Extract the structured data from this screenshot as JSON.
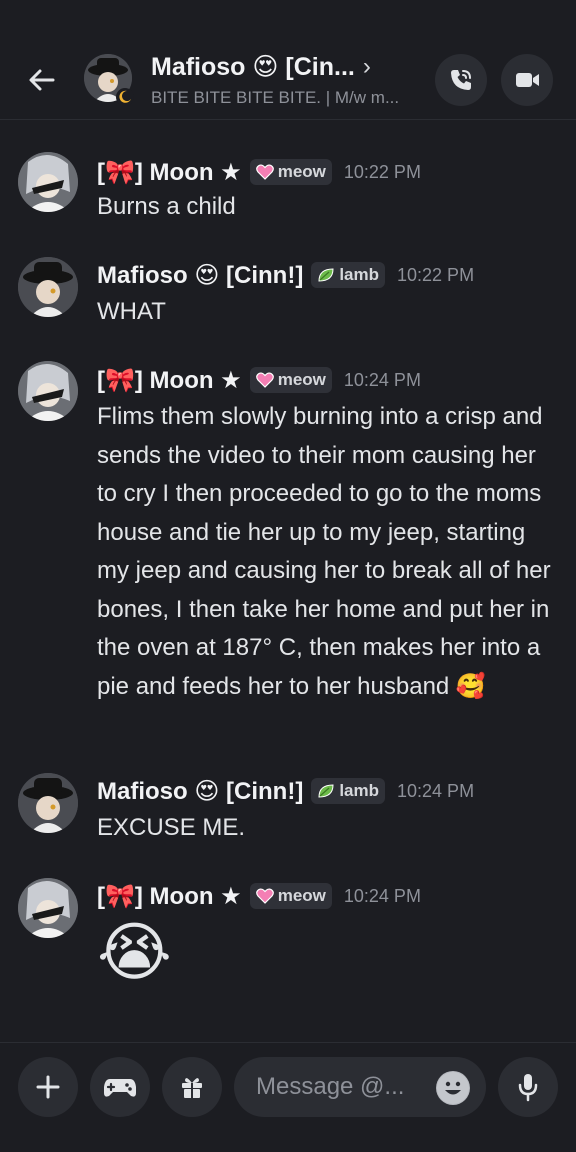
{
  "header": {
    "title": "Mafioso 😍 [Cin...",
    "chevron": "›",
    "subtitle": "BITE BITE BITE BITE. | M/w m...",
    "icons": [
      "back-arrow-icon",
      "call-icon",
      "video-icon"
    ]
  },
  "messages": [
    {
      "author": "[🎀] Moon ★",
      "tag": "meow",
      "tag_icon": "pink-heart-icon",
      "time": "10:22 PM",
      "text": "Burns a child"
    },
    {
      "author": "Mafioso 😍 [Cinn!]",
      "tag": "lamb",
      "tag_icon": "green-leaf-icon",
      "time": "10:22 PM",
      "text": "WHAT"
    },
    {
      "author": "[🎀] Moon ★",
      "tag": "meow",
      "tag_icon": "pink-heart-icon",
      "time": "10:24 PM",
      "text": "Flims them slowly burning into a crisp and sends the video to their mom causing her to cry I then proceeded to go to the moms house and tie her up to my jeep, starting my jeep and causing her to break all of her bones, I then take her home and put her in the oven at 187° C, then makes her into a pie and feeds her to her husband 🥰"
    },
    {
      "author": "Mafioso 😍 [Cinn!]",
      "tag": "lamb",
      "tag_icon": "green-leaf-icon",
      "time": "10:24 PM",
      "text": "EXCUSE ME."
    },
    {
      "author": "[🎀] Moon ★",
      "tag": "meow",
      "tag_icon": "pink-heart-icon",
      "time": "10:24 PM",
      "text": "😭"
    }
  ],
  "composer": {
    "placeholder": "Message @...",
    "icons": [
      "plus-icon",
      "gamepad-icon",
      "gift-icon",
      "emoji-icon",
      "microphone-icon"
    ]
  },
  "colors": {
    "background": "#1c1d22",
    "button_bg": "#2b2d33",
    "muted_text": "#8e9199",
    "tag_bg": "#2f3138",
    "heart": "#f47fb4",
    "leaf": "#6dbb4a"
  }
}
